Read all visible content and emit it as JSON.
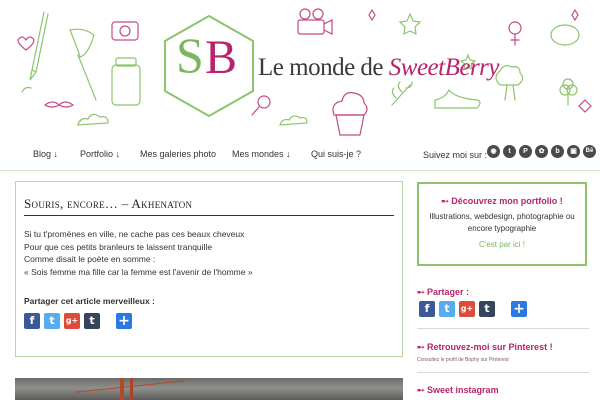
{
  "header": {
    "logo_s": "S",
    "logo_b": "B",
    "site_title_prefix": "Le monde de ",
    "site_title_accent": "SweetBerry",
    "colors": {
      "green": "#7bb661",
      "pink": "#b7246b"
    }
  },
  "nav": {
    "items": [
      {
        "label": "Blog ↓"
      },
      {
        "label": "Portfolio ↓"
      },
      {
        "label": "Mes galeries photo"
      },
      {
        "label": "Mes mondes ↓"
      },
      {
        "label": "Qui suis-je ?"
      }
    ],
    "follow_label": "Suivez moi sur :",
    "social_icons": [
      "rss-icon",
      "tumblr-icon",
      "pinterest-icon",
      "flickr-icon",
      "blog-icon",
      "instagram-icon",
      "behance-icon"
    ],
    "social_glyphs": [
      "◉",
      "t",
      "P",
      "✿",
      "b",
      "▣",
      "Bē"
    ]
  },
  "article": {
    "title": "Souris, encore… – Akhenaton",
    "lines": [
      "Si tu t'promènes en ville, ne cache pas ces beaux cheveux",
      "Pour que ces petits branleurs te laissent tranquille",
      "Comme disait le poète en somme :",
      "« Sois femme ma fille car la femme est l'avenir de l'homme »"
    ],
    "share_label": "Partager cet article merveilleux :",
    "share_buttons": [
      {
        "name": "facebook-icon",
        "glyph": "f",
        "color": "#3b5998"
      },
      {
        "name": "twitter-icon",
        "glyph": "t",
        "color": "#55acee"
      },
      {
        "name": "googleplus-icon",
        "glyph": "g+",
        "color": "#dd4b39"
      },
      {
        "name": "tumblr-icon",
        "glyph": "t",
        "color": "#35465c"
      },
      {
        "name": "share-more-icon",
        "glyph": "+",
        "color": "#2a7ae2"
      }
    ]
  },
  "sidebar": {
    "portfolio_title": "➸ Découvrez mon portfolio !",
    "portfolio_desc": "Illustrations, webdesign, photographie ou encore typographie",
    "portfolio_link": "C'est par ici !",
    "share_heading": "➸ Partager :",
    "pinterest_heading": "➸ Retrouvez-moi sur Pinterest !",
    "pinterest_small": "Consultez le profil de Bophy sur Pinterest",
    "instagram_heading": "➸ Sweet instagram"
  }
}
